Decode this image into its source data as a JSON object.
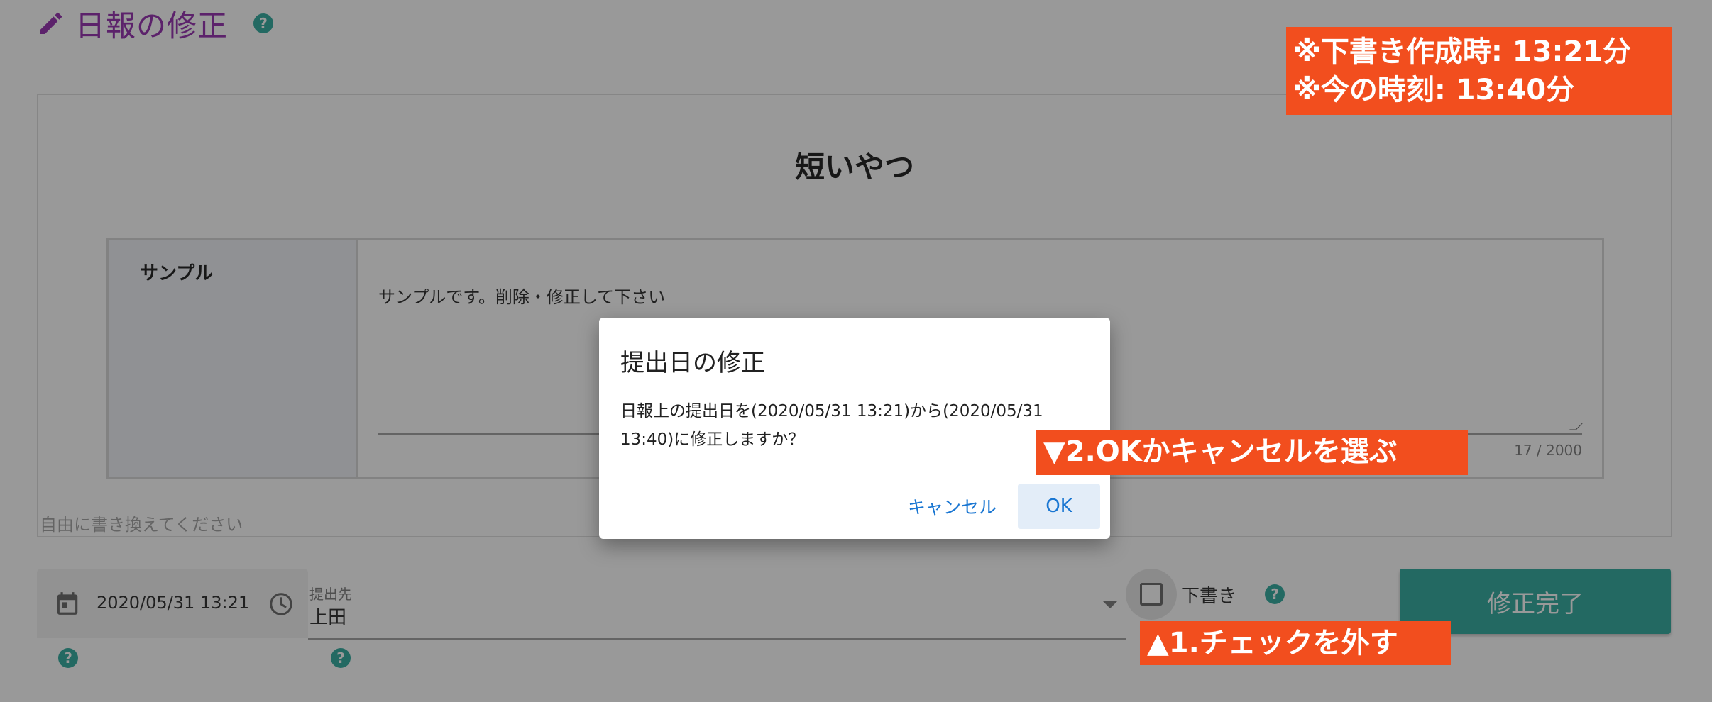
{
  "header": {
    "title": "日報の修正"
  },
  "report": {
    "title": "短いやつ",
    "row_label": "サンプル",
    "content": "サンプルです。削除・修正して下さい",
    "char_counter": "17 / 2000",
    "hint": "自由に書き換えてください"
  },
  "footer": {
    "datetime": "2020/05/31 13:21",
    "dest_label": "提出先",
    "dest_value": "上田",
    "draft_label": "下書き",
    "draft_checked": false,
    "submit_label": "修正完了"
  },
  "dialog": {
    "title": "提出日の修正",
    "body_line1": "日報上の提出日を(2020/05/31 13:21)から(2020/05/31",
    "body_line2": "13:40)に修正しますか？",
    "cancel_label": "キャンセル",
    "ok_label": "OK"
  },
  "annotations": {
    "draft_time": "※下書き作成時: 13:21分",
    "now_time": "※今の時刻: 13:40分",
    "choose": "▼2.OKかキャンセルを選ぶ",
    "uncheck": "▲1.チェックを外す"
  },
  "colors": {
    "title_purple": "#8e24aa",
    "teal": "#26a69a",
    "link_blue": "#1976d2",
    "annotation_orange": "#f24e1e"
  },
  "icons": {
    "header": "pencil-icon",
    "help": "help-icon",
    "date": "calendar-icon",
    "time": "clock-icon",
    "select": "chevron-down-icon"
  }
}
